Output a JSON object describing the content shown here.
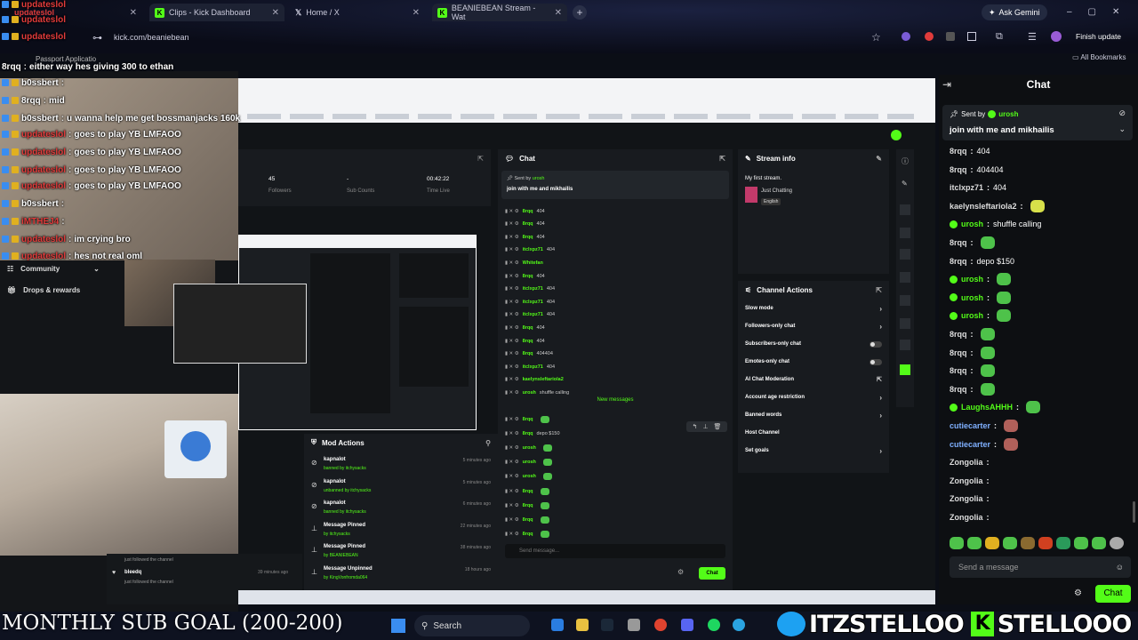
{
  "browser": {
    "tabs": [
      {
        "label": "updateslol"
      },
      {
        "label": "Clips - Kick Dashboard"
      },
      {
        "label": "Home / X"
      },
      {
        "label": "BEANIEBEAN Stream - Wat"
      }
    ],
    "ask_gemini": "Ask Gemini",
    "url": "kick.com/beaniebean",
    "finish_update": "Finish update",
    "all_bookmarks": "All Bookmarks",
    "passport": "Passport Applicatio"
  },
  "overlay_chat": [
    {
      "user": "8rqq",
      "msg": "either way hes giving 300 to ethan",
      "color": "#ffffff"
    },
    {
      "user": "b0ssbert",
      "msg": "",
      "color": "#ffffff"
    },
    {
      "user": "8rqq",
      "msg": "mid",
      "color": "#ffffff"
    },
    {
      "user": "b0ssbert",
      "msg": "u wanna help me get bossmanjacks 160k",
      "color": "#ffffff"
    },
    {
      "user": "updateslol",
      "msg": "goes to play YB LMFAOO",
      "color": "#e03b3b"
    },
    {
      "user": "updateslol",
      "msg": "goes to play YB LMFAOO",
      "color": "#e03b3b"
    },
    {
      "user": "updateslol",
      "msg": "goes to play YB LMFAOO",
      "color": "#e03b3b"
    },
    {
      "user": "updateslol",
      "msg": "goes to play YB LMFAOO",
      "color": "#e03b3b"
    },
    {
      "user": "b0ssbert",
      "msg": "",
      "color": "#ffffff"
    },
    {
      "user": "iMTHEJ4",
      "msg": "",
      "color": "#e03b3b"
    },
    {
      "user": "updateslol",
      "msg": "im crying bro",
      "color": "#e03b3b"
    },
    {
      "user": "updateslol",
      "msg": "hes not real oml",
      "color": "#e03b3b"
    }
  ],
  "overlay_top": [
    {
      "user": "updateslol"
    },
    {
      "user": "updateslol"
    },
    {
      "user": "updateslol"
    }
  ],
  "sidebar": {
    "community": "Community",
    "drops": "Drops & rewards"
  },
  "dashboard": {
    "stats": [
      {
        "value": "45",
        "label": "Followers"
      },
      {
        "value": "-",
        "label": "Sub Counts"
      },
      {
        "value": "00:42:22",
        "label": "Time Live"
      }
    ],
    "chat_title": "Chat",
    "sent_by": "Sent by",
    "sent_by_user": "urosh",
    "pinned_msg": "join with me and mikhailis",
    "chat_lines": [
      {
        "user": "8rqq",
        "msg": "404"
      },
      {
        "user": "8rqq",
        "msg": "404"
      },
      {
        "user": "8rqq",
        "msg": "404"
      },
      {
        "user": "itclxpz71",
        "msg": "404"
      },
      {
        "user": "Whitefan",
        "msg": ""
      },
      {
        "user": "8rqq",
        "msg": "404"
      },
      {
        "user": "itclxpz71",
        "msg": "404"
      },
      {
        "user": "itclxpz71",
        "msg": "404"
      },
      {
        "user": "itclxpz71",
        "msg": "404"
      },
      {
        "user": "8rqq",
        "msg": "404"
      },
      {
        "user": "8rqq",
        "msg": "404"
      },
      {
        "user": "8rqq",
        "msg": "404404"
      },
      {
        "user": "itclxpz71",
        "msg": "404"
      },
      {
        "user": "kaelynsleftariola2",
        "msg": ""
      },
      {
        "user": "urosh",
        "msg": "shuffle calling"
      }
    ],
    "new_messages": "New messages",
    "chat_lines2": [
      {
        "user": "8rqq",
        "msg": ""
      },
      {
        "user": "8rqq",
        "msg": "depo $150"
      },
      {
        "user": "urosh",
        "msg": ""
      },
      {
        "user": "urosh",
        "msg": ""
      },
      {
        "user": "urosh",
        "msg": ""
      },
      {
        "user": "8rqq",
        "msg": ""
      },
      {
        "user": "8rqq",
        "msg": ""
      },
      {
        "user": "8rqq",
        "msg": ""
      },
      {
        "user": "8rqq",
        "msg": ""
      }
    ],
    "send_placeholder": "Send message...",
    "chat_btn": "Chat",
    "stream_info": {
      "title": "Stream info",
      "stream_title": "My first stream.",
      "category": "Just Chatting",
      "language": "English"
    },
    "channel_actions": {
      "title": "Channel Actions",
      "items": [
        {
          "label": "Slow mode",
          "ctl": "arrow"
        },
        {
          "label": "Followers-only chat",
          "ctl": "arrow"
        },
        {
          "label": "Subscribers-only chat",
          "ctl": "toggle"
        },
        {
          "label": "Emotes-only chat",
          "ctl": "toggle"
        },
        {
          "label": "AI Chat Moderation",
          "ctl": "ext"
        },
        {
          "label": "Account age restriction",
          "ctl": "arrow"
        },
        {
          "label": "Banned words",
          "ctl": "arrow"
        },
        {
          "label": "Host Channel",
          "ctl": "none"
        },
        {
          "label": "Set goals",
          "ctl": "arrow"
        }
      ]
    },
    "mod_actions": {
      "title": "Mod Actions",
      "items": [
        {
          "title": "kapnalot",
          "sub": "banned by itchysacks",
          "time": "5 minutes ago"
        },
        {
          "title": "kapnalot",
          "sub": "unbanned by itchysacks",
          "time": "5 minutes ago"
        },
        {
          "title": "kapnalot",
          "sub": "banned by itchysacks",
          "time": "6 minutes ago"
        },
        {
          "title": "Message Pinned",
          "sub": "by itchysacks",
          "time": "22 minutes ago"
        },
        {
          "title": "Message Pinned",
          "sub": "by BEANIEBEAN",
          "time": "38 minutes ago"
        },
        {
          "title": "Message Unpinned",
          "sub": "by KingVonfromda064",
          "time": "18 hours ago"
        }
      ]
    },
    "activity": [
      {
        "label": "just followed the channel",
        "time": ""
      },
      {
        "label": "bleedq",
        "time": "39 minutes ago"
      },
      {
        "label": "just followed the channel",
        "time": ""
      }
    ]
  },
  "right_chat": {
    "title": "Chat",
    "sent_by": "Sent by",
    "sent_by_user": "urosh",
    "pinned_msg": "join with me and mikhailis",
    "lines": [
      {
        "user": "8rqq",
        "msg": "404",
        "cls": "rname",
        "emote": false
      },
      {
        "user": "8rqq",
        "msg": "404404",
        "cls": "rname",
        "emote": false
      },
      {
        "user": "itclxpz71",
        "msg": "404",
        "cls": "rname",
        "emote": false
      },
      {
        "user": "kaelynsleftariola2",
        "msg": "",
        "cls": "rname",
        "emote": true
      },
      {
        "user": "urosh",
        "msg": "shuffle calling",
        "cls": "gname",
        "emote": false
      },
      {
        "user": "8rqq",
        "msg": "",
        "cls": "rname",
        "emote": true
      },
      {
        "user": "8rqq",
        "msg": "depo $150",
        "cls": "rname",
        "emote": false
      },
      {
        "user": "urosh",
        "msg": "",
        "cls": "gname",
        "emote": true
      },
      {
        "user": "urosh",
        "msg": "",
        "cls": "gname",
        "emote": true
      },
      {
        "user": "urosh",
        "msg": "",
        "cls": "gname",
        "emote": true
      },
      {
        "user": "8rqq",
        "msg": "",
        "cls": "rname",
        "emote": true
      },
      {
        "user": "8rqq",
        "msg": "",
        "cls": "rname",
        "emote": true
      },
      {
        "user": "8rqq",
        "msg": "",
        "cls": "rname",
        "emote": true
      },
      {
        "user": "8rqq",
        "msg": "",
        "cls": "rname",
        "emote": true
      },
      {
        "user": "LaughsAHHH",
        "msg": "",
        "cls": "gname",
        "emote": true
      },
      {
        "user": "cutiecarter",
        "msg": "",
        "cls": "bname",
        "emote": true
      },
      {
        "user": "cutiecarter",
        "msg": "",
        "cls": "bname",
        "emote": true
      },
      {
        "user": "Zongolia",
        "msg": "",
        "cls": "rname",
        "emote": false
      },
      {
        "user": "Zongolia",
        "msg": "",
        "cls": "rname",
        "emote": false
      },
      {
        "user": "Zongolia",
        "msg": "",
        "cls": "rname",
        "emote": false
      },
      {
        "user": "Zongolia",
        "msg": "",
        "cls": "rname",
        "emote": false
      }
    ],
    "send_placeholder": "Send a message",
    "chat_btn": "Chat"
  },
  "taskbar": {
    "search": "Search"
  },
  "banner": {
    "sub_goal": "MONTHLY SUB GOAL (200-200)",
    "twitter": "ITZSTELLOO",
    "kick": "STELLOOO"
  },
  "colors": {
    "kick_green": "#53fc18",
    "name_red": "#e03b3b"
  }
}
